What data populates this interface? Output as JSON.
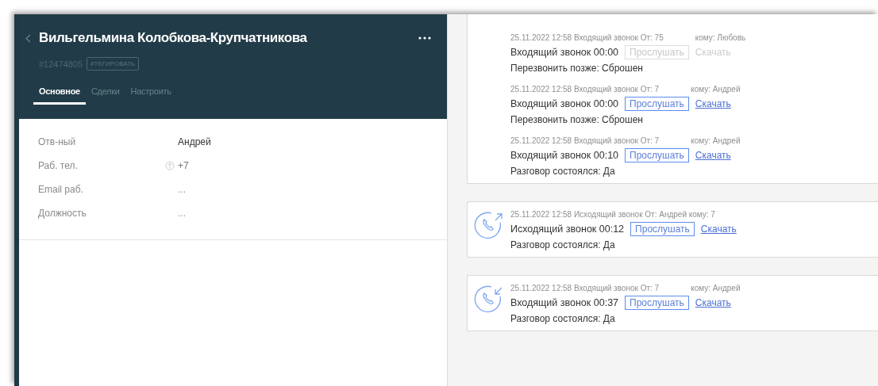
{
  "contact": {
    "name": "Вильгельмина Колобкова-Крупчатникова",
    "id": "#12474805",
    "tag": "#ТЕГИРОВАТЬ",
    "tabs": [
      {
        "label": "Основное",
        "selected": true
      },
      {
        "label": "Сделки",
        "selected": false
      },
      {
        "label": "Настроить",
        "selected": false
      }
    ],
    "fields": [
      {
        "label": "Отв-ный",
        "value": "Андрей",
        "kind": "text"
      },
      {
        "label": "Раб. тел.",
        "value": "+7",
        "kind": "phone"
      },
      {
        "label": "Email раб.",
        "value": "...",
        "kind": "empty"
      },
      {
        "label": "Должность",
        "value": "...",
        "kind": "empty"
      }
    ]
  },
  "feed": [
    {
      "kind": "plain",
      "calls": [
        {
          "meta": "25.11.2022 12:58 Входящий звонок От: 75",
          "recipient": "кому: Любовь",
          "summary": "Входящий звонок 00:00",
          "listen": "Прослушать",
          "download": "Скачать",
          "disabled": true,
          "result": "Перезвонить позже: Сброшен"
        },
        {
          "meta": "25.11.2022 12:58 Входящий звонок От: 7",
          "recipient": "кому: Андрей",
          "summary": "Входящий звонок 00:00",
          "listen": "Прослушать",
          "download": "Скачать",
          "disabled": false,
          "result": "Перезвонить позже: Сброшен"
        },
        {
          "meta": "25.11.2022 12:58 Входящий звонок От: 7",
          "recipient": "кому: Андрей",
          "summary": "Входящий звонок 00:10",
          "listen": "Прослушать",
          "download": "Скачать",
          "disabled": false,
          "result": "Разговор состоялся: Да"
        }
      ]
    },
    {
      "kind": "outgoing",
      "calls": [
        {
          "meta": "25.11.2022 12:58 Исходящий звонок От: Андрей кому: 7",
          "summary": "Исходящий звонок 00:12",
          "listen": "Прослушать",
          "download": "Скачать",
          "disabled": false,
          "result": "Разговор состоялся: Да"
        }
      ]
    },
    {
      "kind": "incoming",
      "calls": [
        {
          "meta": "25.11.2022 12:58 Входящий звонок От: 7",
          "recipient": "кому: Андрей",
          "summary": "Входящий звонок 00:37",
          "listen": "Прослушать",
          "download": "Скачать",
          "disabled": false,
          "result": "Разговор состоялся: Да"
        }
      ]
    }
  ]
}
